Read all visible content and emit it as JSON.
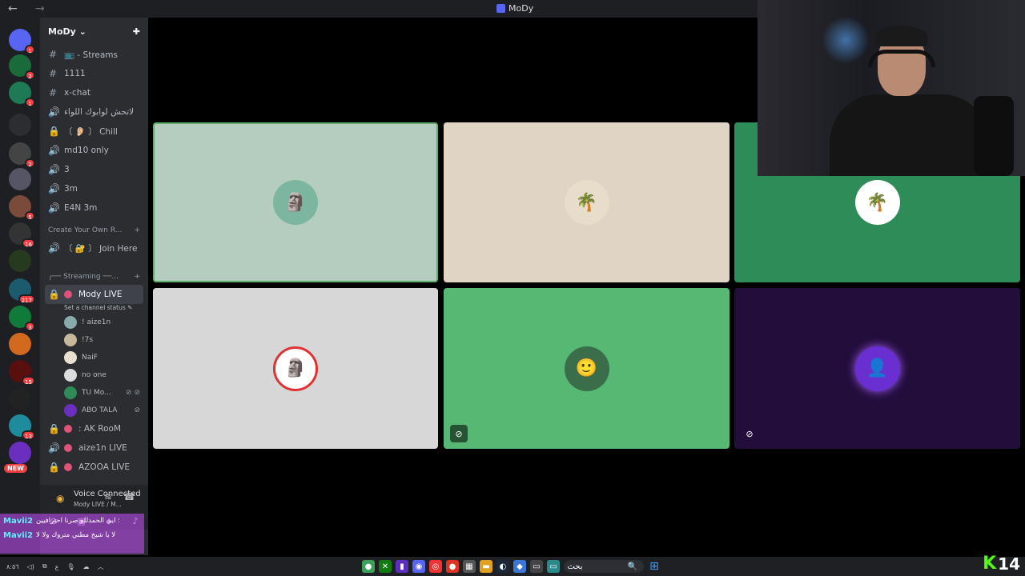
{
  "window": {
    "title": "MoDy",
    "back_icon": "←",
    "forward_icon": "→"
  },
  "servers": [
    {
      "name": "discord-home",
      "badge": "1",
      "color": "#5865f2"
    },
    {
      "name": "server-palm",
      "badge": "2",
      "color": "#1a6b3c"
    },
    {
      "name": "server-2",
      "badge": "1",
      "color": "#1d7a55"
    },
    {
      "name": "folder",
      "badge": "",
      "color": "#2b2d31"
    },
    {
      "name": "server-4",
      "badge": "2",
      "color": "#444"
    },
    {
      "name": "server-5",
      "badge": "",
      "color": "#556"
    },
    {
      "name": "server-6",
      "badge": "5",
      "color": "#7a4a3a"
    },
    {
      "name": "server-7",
      "badge": "16",
      "color": "#333"
    },
    {
      "name": "server-8",
      "badge": "",
      "color": "#263a20"
    },
    {
      "name": "server-9",
      "badge": "217",
      "color": "#1c5a6e"
    },
    {
      "name": "server-10",
      "badge": "3",
      "color": "#0f7a3a"
    },
    {
      "name": "server-11",
      "badge": "",
      "color": "#d2691e"
    },
    {
      "name": "server-12",
      "badge": "15",
      "color": "#5a0f0f"
    },
    {
      "name": "server-13",
      "badge": "",
      "color": "#222"
    },
    {
      "name": "server-14",
      "badge": "13",
      "color": "#1e8c9c"
    },
    {
      "name": "server-15",
      "badge": "",
      "color": "#6b2fbf",
      "new": "NEW"
    }
  ],
  "guild": {
    "name": "MoDy",
    "chevron": "⌄",
    "add_icon": "✚"
  },
  "channels": [
    {
      "icon": "#",
      "label": "📺 - Streams"
    },
    {
      "icon": "#",
      "label": "1111"
    },
    {
      "icon": "#",
      "label": "x-chat"
    },
    {
      "icon": "🔊",
      "label": "لاتحش لوابوك اللواء"
    },
    {
      "icon": "🔒",
      "label": "〔 👂🏻 〕 Chill"
    },
    {
      "icon": "🔊",
      "label": "md10 only"
    },
    {
      "icon": "🔊",
      "label": "3"
    },
    {
      "icon": "🔊",
      "label": "3m"
    },
    {
      "icon": "🔊",
      "label": "E4N 3m"
    }
  ],
  "category1": {
    "label": "Create Your Own R...",
    "add": "+"
  },
  "channel_join": {
    "icon": "🔊",
    "label": "〔 🔐 〕 Join Here"
  },
  "category2": {
    "label": "╭── Streaming ──...",
    "add": "+"
  },
  "active_channel": {
    "icon": "🔒",
    "label": "Mody LIVE",
    "status": "Set a channel status ✎"
  },
  "voice_users": [
    {
      "name": "! aize1n",
      "color": "#8aa",
      "right": ""
    },
    {
      "name": "!7s",
      "color": "#c8b89a",
      "right": ""
    },
    {
      "name": "NaiF",
      "color": "#e8e0d0",
      "right": ""
    },
    {
      "name": "no one",
      "color": "#ddd",
      "right": ""
    },
    {
      "name": "TU Mo...",
      "color": "#2e8b57",
      "right": "⊘ ⊘"
    },
    {
      "name": "ABO TALA",
      "color": "#6b2fbf",
      "right": "⊘"
    }
  ],
  "more_channels": [
    {
      "icon": "🔒",
      "label": ": AK RooM"
    },
    {
      "icon": "🔊",
      "label": "aize1n LIVE"
    },
    {
      "icon": "🔒",
      "label": "AZOOA LIVE"
    }
  ],
  "voice_panel": {
    "title": "Voice Connected",
    "subtitle": "Mody LIVE / M...",
    "signal": "◉",
    "noise": "≋",
    "disconnect": "☎"
  },
  "voice_actions": [
    "⊘",
    "▣",
    "✦",
    "♪"
  ],
  "chat_overlay": [
    {
      "name": "Mavii2",
      "text": "ايي الحمدلله صرنا احترافيين :"
    },
    {
      "name": "Mavii2",
      "text": "لا يا شيخ مطني متروك ولا لا"
    }
  ],
  "tiles": [
    {
      "name": "tile-1",
      "bg": "#b4cdbf",
      "avatar_bg": "#7db6a0",
      "glyph": "🗿",
      "border": "#5fae6a"
    },
    {
      "name": "tile-2",
      "bg": "#e0d4c5",
      "avatar_bg": "#e8dccb",
      "glyph": "🌴",
      "border": ""
    },
    {
      "name": "tile-3",
      "bg": "#2d8c58",
      "avatar_bg": "#ffffff",
      "glyph": "🌴",
      "border": ""
    },
    {
      "name": "tile-4",
      "bg": "#d7d7d7",
      "avatar_bg": "#ffffff",
      "glyph": "🗿",
      "border": ""
    },
    {
      "name": "tile-5",
      "bg": "#56b872",
      "avatar_bg": "#3a6e4a",
      "glyph": "🙂",
      "border": ""
    },
    {
      "name": "tile-6",
      "bg": "#220d3b",
      "avatar_bg": "#6a2fd0",
      "glyph": "👤",
      "border": ""
    }
  ],
  "tile_corner_icons": {
    "tile5": "⊘",
    "tile6": "⊘"
  },
  "taskbar": {
    "left": [
      "٨:٥٦",
      "◁)",
      "⧉",
      "ع",
      "🎙",
      "☁",
      "︿"
    ],
    "search_text": "بحث",
    "search_icon": "🔍",
    "windows_icon": "⊞"
  },
  "kick": {
    "k": "K",
    "n": "14"
  }
}
